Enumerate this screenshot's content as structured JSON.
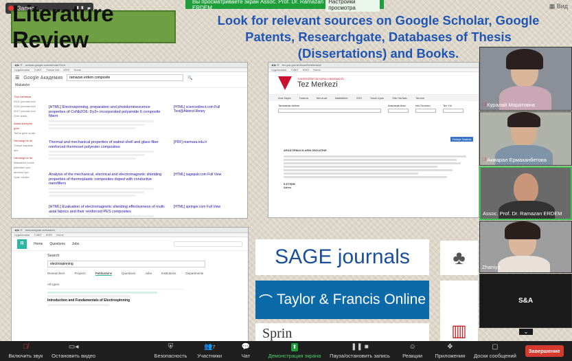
{
  "recording": {
    "label": "Запись..."
  },
  "share_bar": {
    "text": "Вы просматриваете экран Assoc. Prof. Dr. Ramazan ERDEM",
    "settings": "Настройки просмотра"
  },
  "view_label": "Вид",
  "slide": {
    "title": "Literature Review",
    "headline": "Look for relevant sources on Google Scholar, Google Patents, Researchgate, Databases of Thesis (Dissertations) and Books."
  },
  "scholar": {
    "logo": "Google Академия",
    "query": "ramazan erdem composite",
    "articles_label": "Makaleler",
    "left_menu": [
      "Tüm zamanlar",
      "2021 yılından beri",
      "2020 yılından beri",
      "2017 yılından beri",
      "Özel aralık...",
      "Alaka düzeyine göre",
      "Tarihe göre sırala",
      "Herhangi bir dil",
      "Türkçe sayfaları ara",
      "Herhangi bir tür",
      "Makaleleri incele",
      "patentleri içer",
      "alıntıları içer",
      "Uyarı oluştur"
    ],
    "results": [
      {
        "title": "[HTML] Electrospinning, preparation and photoluminescence properties of CoNb2O6: Dy3+ incorporated polyamide 6 composite fibers",
        "side": "[HTML] sciencedirect.com Full Text@Aktenzl.library"
      },
      {
        "title": "Thermal and mechanical properties of walnut shell and glass fiber reinforced thermoset polyester composites",
        "side": "[PDF] marmara.edu.tr"
      },
      {
        "title": "Analysis of the mechanical, electrical and electromagnetic shielding properties of thermoplastic composites doped with conductive nanofillers",
        "side": "[HTML] sagepub.com Full View"
      },
      {
        "title": "[HTML] Evaluation of electromagnetic shielding effectiveness of multi-axial fabrics and their reinforced PES composites",
        "side": "[HTML] springer.com Full View"
      }
    ]
  },
  "tez": {
    "org": "YÜKSEKÖĞRETİM KURULU BAŞKANLIĞI",
    "name": "Tez Merkezi",
    "nav": [
      "Ana Sayfa",
      "Tarama",
      "Mevzuat",
      "İstatistikler",
      "SSS",
      "Yasal Uyarı",
      "Site Haritası",
      "Tanıtım"
    ],
    "fields": {
      "search": "Taranacak kelime",
      "search_in": "Aranacak Alan",
      "thesis_type": "İzin Durumu",
      "year": "Tez Yılı"
    },
    "button": "Detaylı Tarama",
    "announce_title": "ARAŞTIRMACILARIN DİKKATİNE",
    "contact": "İLETİŞİM",
    "address": "Adres"
  },
  "rg": {
    "logo": "R",
    "nav": [
      "Home",
      "Questions",
      "Jobs"
    ],
    "search_label": "Search",
    "query": "electrospinning",
    "tabs": [
      "Researchers",
      "Projects",
      "Publications",
      "Questions",
      "Jobs",
      "Institutions",
      "Departments"
    ],
    "filter": "All types",
    "result_title": "Introduction and Fundamentals of Electrospinning"
  },
  "logos": {
    "sage": "SAGE journals",
    "tf": "Taylor & Francis Online",
    "springer": "Sprin"
  },
  "participants": [
    {
      "name": "Куралай Маратовна",
      "muted": true
    },
    {
      "name": "Акмарал Ермаханбетова",
      "muted": true
    },
    {
      "name": "Assoc. Prof. Dr. Ramazan ERDEM",
      "muted": false
    },
    {
      "name": "Zhaniya",
      "muted": false
    },
    {
      "name": "S&A",
      "muted": false
    }
  ],
  "toolbar": {
    "unmute": "Включить звук",
    "video": "Остановить видео",
    "security": "Безопасность",
    "participants": "Участники",
    "participants_count": "7",
    "chat": "Чат",
    "share": "Демонстрация экрана",
    "pause": "Пауза/остановить запись",
    "reactions": "Реакции",
    "apps": "Приложения",
    "whiteboard": "Доски сообщений",
    "end": "Завершение"
  }
}
